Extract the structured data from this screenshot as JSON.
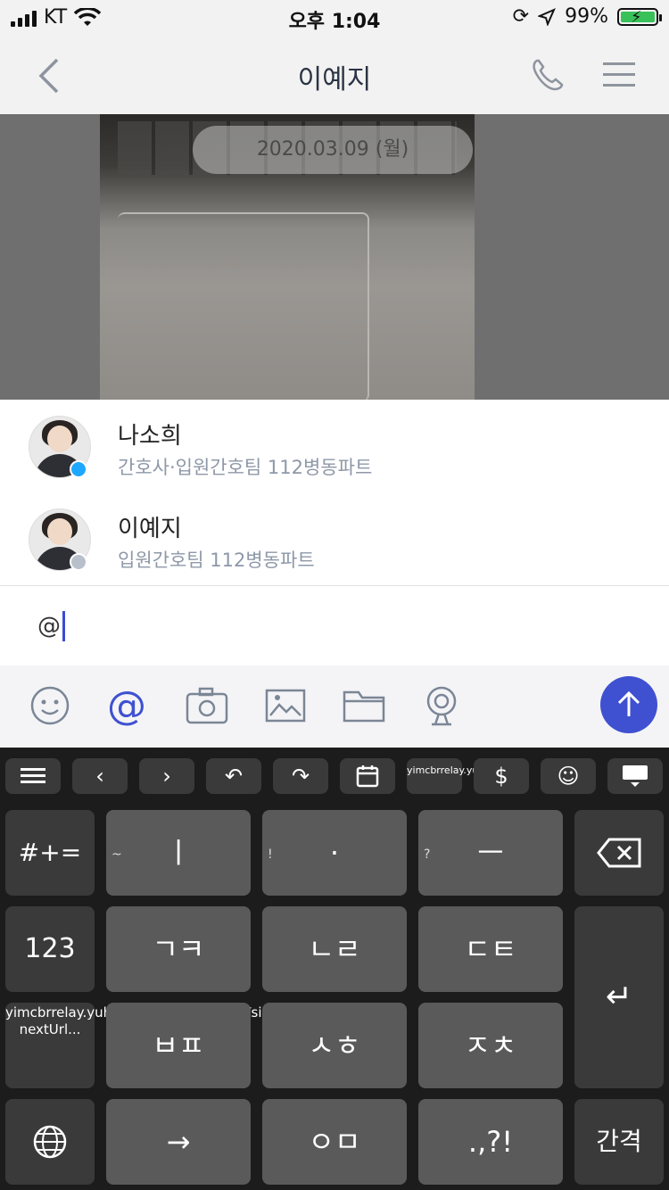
{
  "status": {
    "carrier": "KT",
    "time": "오후 1:04",
    "battery": "99%",
    "battery_level": 0.99,
    "icons": [
      "signal-icon",
      "wifi-icon",
      "rotation-lock-icon",
      "location-icon",
      "battery-icon"
    ]
  },
  "header": {
    "title": "이예지"
  },
  "chat": {
    "date": "2020.03.09 (월)"
  },
  "mentions": [
    {
      "name": "나소희",
      "dept": "간호사·입원간호팀 112병동파트",
      "status_color": "#1ea7ff"
    },
    {
      "name": "이예지",
      "dept": "입원간호팀 112병동파트",
      "status_color": "#b9c0cc"
    }
  ],
  "input": {
    "value": "@"
  },
  "toolbar": {
    "mention_label": "@",
    "accent": "#3f51d1"
  },
  "keyboard": {
    "shortcut_label": "yimcbrrelay.yuh...",
    "long_label": "yimcbrrelay.yuhs.ac/auth/mobile/ios/signin?nextUrl...",
    "keys": {
      "symbols": "#+=",
      "numbers": "123",
      "r1c1": "ㅣ",
      "r1c1_sup": "~",
      "r1c2": "·",
      "r1c2_sup": "!",
      "r1c3": "ㅡ",
      "r1c3_sup": "?",
      "r2c1": "ㄱㅋ",
      "r2c2": "ㄴㄹ",
      "r2c3": "ㄷㅌ",
      "r3c1": "ㅂㅍ",
      "r3c2": "ㅅㅎ",
      "r3c3": "ㅈㅊ",
      "r4c1": "→",
      "r4c2": "ㅇㅁ",
      "r4c3": ".,?!",
      "space": "간격",
      "return": "↵",
      "backspace": "⌫"
    }
  }
}
